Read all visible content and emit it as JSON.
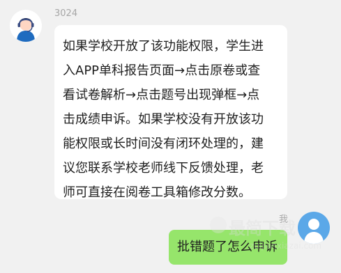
{
  "chat": {
    "agent": {
      "name": "3024",
      "avatar_icon": "support-agent-avatar-icon",
      "message": "如果学校开放了该功能权限，学生进\n入APP单科报告页面→点击原卷或查\n看试卷解析→点击题号出现弹框→点\n击成绩申诉。如果学校没有开放该功\n能权限或长时间没有闭环处理的，建\n议您联系学校老师线下反馈处理，老\n师可直接在阅卷工具箱修改分数。"
    },
    "user": {
      "name": "我",
      "avatar_icon": "user-avatar-icon",
      "message": "批错题了怎么申诉"
    }
  },
  "watermark": {
    "text": "最简下载",
    "url": "zuijianxiazai.com"
  },
  "colors": {
    "background": "#f1f1f1",
    "agent_bubble": "#ffffff",
    "user_bubble": "#96e56b",
    "name_text": "#a6a6a6",
    "user_avatar": "#5ba8e8"
  }
}
